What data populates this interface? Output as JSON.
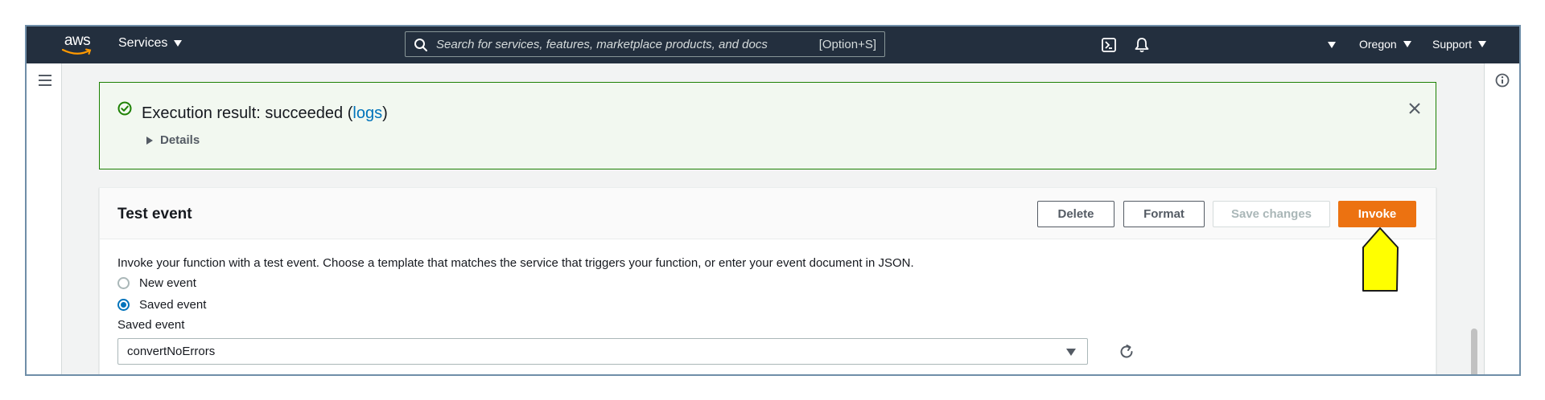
{
  "nav": {
    "logo_text": "aws",
    "services_label": "Services",
    "search_placeholder": "Search for services, features, marketplace products, and docs",
    "search_shortcut": "[Option+S]",
    "region_label": "Oregon",
    "support_label": "Support",
    "icons": [
      "cloudshell-icon",
      "bell-icon",
      "chevron-down-icon",
      "search-icon"
    ]
  },
  "flash": {
    "title_prefix": "Execution result: succeeded (",
    "logs_link": "logs",
    "title_suffix": ")",
    "details_label": "Details",
    "status_color": "#1d8102"
  },
  "test_event": {
    "title": "Test event",
    "buttons": {
      "delete": "Delete",
      "format": "Format",
      "save": "Save changes",
      "invoke": "Invoke"
    },
    "description": "Invoke your function with a test event. Choose a template that matches the service that triggers your function, or enter your event document in JSON.",
    "radio_new": "New event",
    "radio_saved": "Saved event",
    "selected_option": "saved",
    "saved_event_label": "Saved event",
    "saved_event_value": "convertNoErrors"
  },
  "colors": {
    "nav_bg": "#232f3e",
    "accent_orange": "#ec7211",
    "link_blue": "#0073bb",
    "pointer_yellow": "#ffff00"
  }
}
